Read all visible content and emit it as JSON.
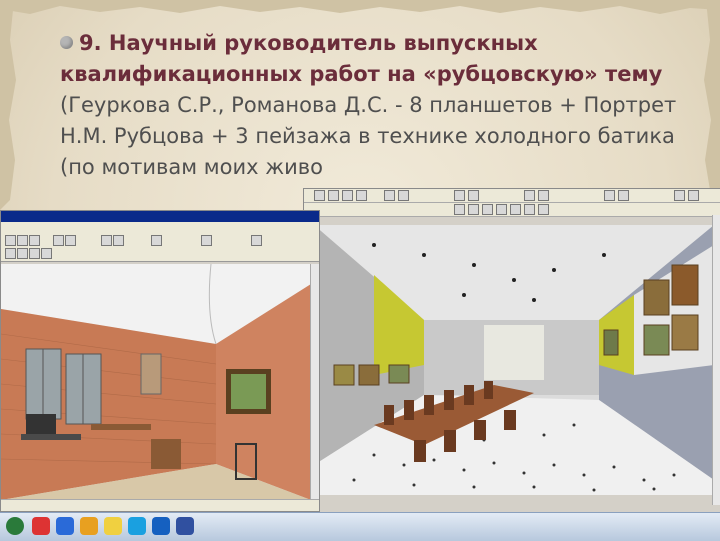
{
  "slide": {
    "heading_bold": "9. Научный руководитель выпускных квалификационных работ на «рубцовскую» тему",
    "body_text": "(Геуркова С.Р., Романова Д.С. - 8 планшетов + Портрет Н.М. Рубцова + 3 пейзажа в технике холодного батика (по мотивам моих живо"
  },
  "colors": {
    "heading": "#6b2d3b",
    "body": "#4f4f4f",
    "paper": "#e9e1d0"
  }
}
